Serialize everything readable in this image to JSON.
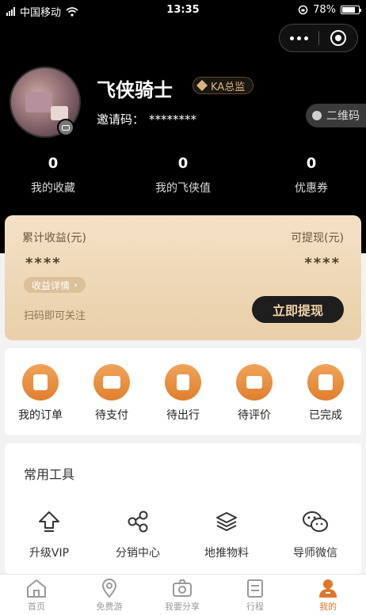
{
  "status_bar": {
    "carrier": "中国移动",
    "time": "13:35",
    "battery": "78%"
  },
  "profile": {
    "username": "飞侠骑士",
    "level_badge": "KA总监",
    "invite_label": "邀请码：",
    "invite_code": "********",
    "qr_button": "二维码"
  },
  "stats": [
    {
      "value": "0",
      "label": "我的收藏"
    },
    {
      "value": "0",
      "label": "我的飞侠值"
    },
    {
      "value": "0",
      "label": "优惠券"
    }
  ],
  "earnings": {
    "total_label": "累计收益(元)",
    "withdrawable_label": "可提现(元)",
    "total_value": "****",
    "withdrawable_value": "****",
    "detail_link": "收益详情",
    "scan_tip": "扫码即可关注",
    "withdraw_button": "立即提现"
  },
  "orders": [
    {
      "label": "我的订单",
      "icon": "order-list-icon"
    },
    {
      "label": "待支付",
      "icon": "wallet-icon"
    },
    {
      "label": "待出行",
      "icon": "luggage-icon"
    },
    {
      "label": "待评价",
      "icon": "comment-icon"
    },
    {
      "label": "已完成",
      "icon": "completed-icon"
    }
  ],
  "tools": {
    "title": "常用工具",
    "items": [
      {
        "label": "升级VIP",
        "icon": "upgrade-arrow-icon"
      },
      {
        "label": "分销中心",
        "icon": "share-nodes-icon"
      },
      {
        "label": "地推物料",
        "icon": "layers-icon"
      },
      {
        "label": "导师微信",
        "icon": "wechat-icon"
      }
    ]
  },
  "tabbar": [
    {
      "label": "首页",
      "icon": "home-icon",
      "active": false
    },
    {
      "label": "免费游",
      "icon": "location-pin-icon",
      "active": false
    },
    {
      "label": "我要分享",
      "icon": "camera-icon",
      "active": false
    },
    {
      "label": "行程",
      "icon": "itinerary-icon",
      "active": false
    },
    {
      "label": "我的",
      "icon": "profile-icon",
      "active": true
    }
  ],
  "colors": {
    "accent": "#e0762a",
    "gold": "#d7b47a",
    "header_bg": "#000000",
    "card_gold": "#efd9b8"
  }
}
